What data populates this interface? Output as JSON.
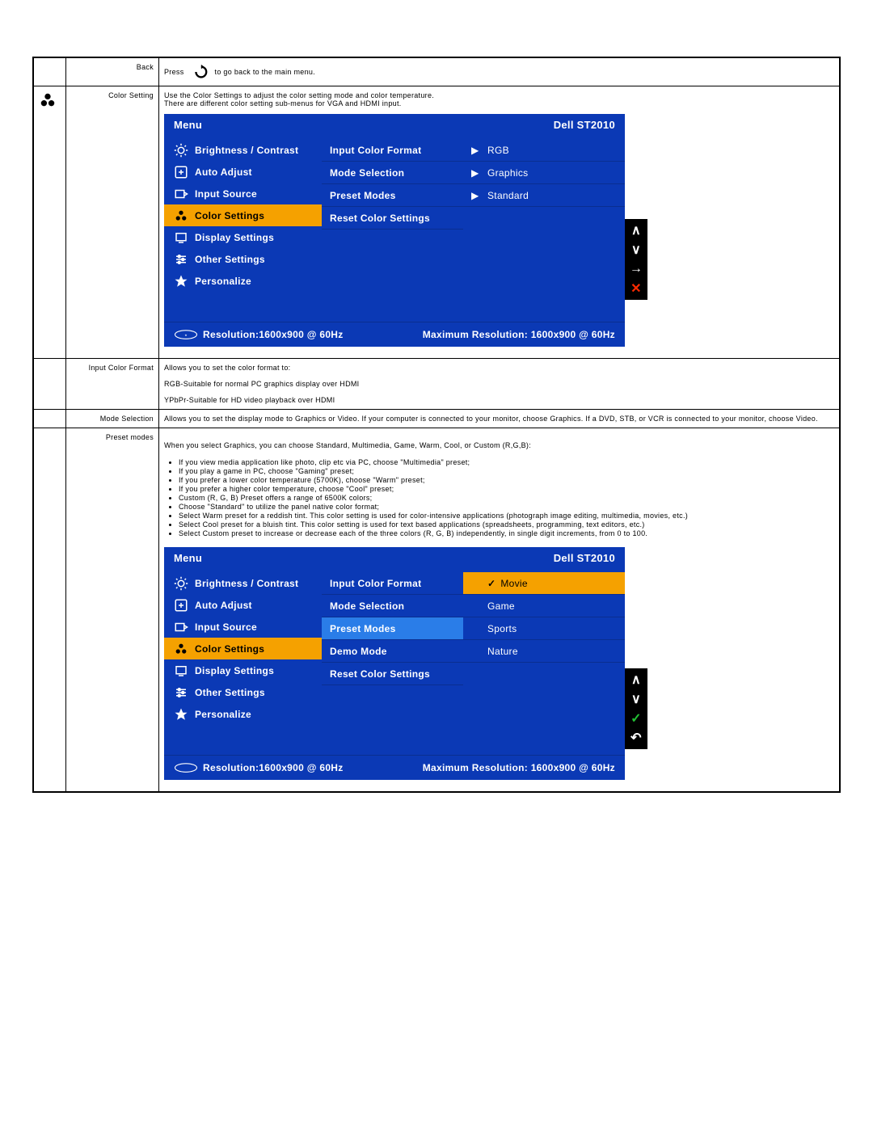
{
  "rows": {
    "back": {
      "label": "Back",
      "press": "Press",
      "press2": "to go back to the main menu."
    },
    "color": {
      "label": "Color Setting",
      "desc1": "Use the Color Settings to adjust the color setting mode and color temperature.",
      "desc2": "There are different color setting sub-menus for VGA and HDMI input."
    },
    "icf": {
      "label": "Input Color Format",
      "l1": "Allows you to set the color format to:",
      "l2": "RGB-Suitable for normal PC graphics display over HDMI",
      "l3": "YPbPr-Suitable for HD video playback over HDMI"
    },
    "mode": {
      "label": "Mode Selection",
      "desc": "Allows you to set the display mode to Graphics or Video. If your computer is connected to your monitor, choose Graphics. If a DVD, STB, or VCR is connected to your monitor, choose Video."
    },
    "preset": {
      "label": "Preset modes",
      "intro": "When you select Graphics, you can choose Standard, Multimedia, Game, Warm, Cool, or Custom (R,G,B):",
      "items": [
        "If you view media application like photo, clip etc via PC, choose \"Multimedia\" preset;",
        "If you play a game in PC, choose \"Gaming\" preset;",
        "If you prefer a lower color temperature (5700K), choose \"Warm\" preset;",
        "If you prefer a higher color temperature, choose \"Cool\" preset;",
        "Custom (R, G, B) Preset offers a range of 6500K colors;",
        "Choose \"Standard\" to utilize the panel native color format;",
        "Select Warm preset for a reddish tint. This color setting is used for color-intensive applications (photograph image editing, multimedia, movies, etc.)",
        "Select Cool preset for a bluish tint. This color setting is used for text based applications (spreadsheets, programming, text editors, etc.)",
        "Select Custom preset to increase or decrease each of the three colors (R, G, B) independently, in single digit increments, from 0 to 100."
      ]
    }
  },
  "osd1": {
    "menu": "Menu",
    "model": "Dell ST2010",
    "left": [
      "Brightness / Contrast",
      "Auto Adjust",
      "Input Source",
      "Color Settings",
      "Display Settings",
      "Other Settings",
      "Personalize"
    ],
    "mid": [
      "Input Color Format",
      "Mode Selection",
      "Preset Modes",
      "Reset Color Settings"
    ],
    "right": [
      "RGB",
      "Graphics",
      "Standard"
    ],
    "res": "Resolution:1600x900 @ 60Hz",
    "maxres": "Maximum Resolution: 1600x900 @ 60Hz"
  },
  "osd2": {
    "menu": "Menu",
    "model": "Dell ST2010",
    "left": [
      "Brightness / Contrast",
      "Auto Adjust",
      "Input Source",
      "Color Settings",
      "Display Settings",
      "Other Settings",
      "Personalize"
    ],
    "mid": [
      "Input Color Format",
      "Mode Selection",
      "Preset Modes",
      "Demo Mode",
      "Reset Color Settings"
    ],
    "right": [
      "Movie",
      "Game",
      "Sports",
      "Nature"
    ],
    "res": "Resolution:1600x900 @ 60Hz",
    "maxres": "Maximum Resolution: 1600x900 @ 60Hz"
  }
}
